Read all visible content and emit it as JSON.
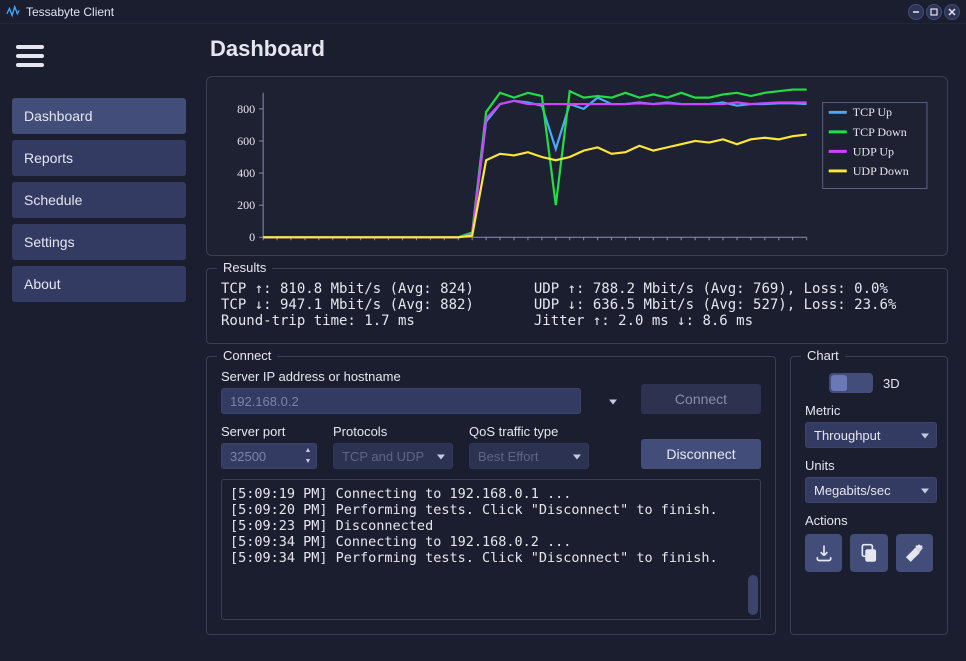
{
  "window": {
    "title": "Tessabyte Client"
  },
  "sidebar": {
    "items": [
      "Dashboard",
      "Reports",
      "Schedule",
      "Settings",
      "About"
    ],
    "active": 0
  },
  "page_title": "Dashboard",
  "results": {
    "legend": "Results",
    "left": "TCP ↑: 810.8 Mbit/s (Avg: 824)\nTCP ↓: 947.1 Mbit/s (Avg: 882)\nRound-trip time: 1.7 ms",
    "right": "UDP ↑: 788.2 Mbit/s (Avg: 769), Loss: 0.0%\nUDP ↓: 636.5 Mbit/s (Avg: 527), Loss: 23.6%\nJitter ↑: 2.0 ms ↓: 8.6 ms"
  },
  "connect": {
    "legend": "Connect",
    "host_label": "Server IP address or hostname",
    "host_value": "192.168.0.2",
    "port_label": "Server port",
    "port_value": "32500",
    "proto_label": "Protocols",
    "proto_value": "TCP and UDP",
    "qos_label": "QoS traffic type",
    "qos_value": "Best Effort",
    "connect_btn": "Connect",
    "disconnect_btn": "Disconnect",
    "log": "[5:09:19 PM] Connecting to 192.168.0.1 ...\n[5:09:20 PM] Performing tests. Click \"Disconnect\" to finish.\n[5:09:23 PM] Disconnected\n[5:09:34 PM] Connecting to 192.168.0.2 ...\n[5:09:34 PM] Performing tests. Click \"Disconnect\" to finish."
  },
  "chart_panel": {
    "legend": "Chart",
    "toggle_3d_label": "3D",
    "metric_label": "Metric",
    "metric_value": "Throughput",
    "units_label": "Units",
    "units_value": "Megabits/sec",
    "actions_label": "Actions"
  },
  "chart_data": {
    "type": "line",
    "ylabel": "",
    "xlabel": "",
    "ylim": [
      0,
      900
    ],
    "yticks": [
      0,
      200,
      400,
      600,
      800
    ],
    "legend_entries": [
      "TCP Up",
      "TCP Down",
      "UDP Up",
      "UDP Down"
    ],
    "colors": {
      "TCP Up": "#4aa8ff",
      "TCP Down": "#22dd44",
      "UDP Up": "#cc44ff",
      "UDP Down": "#ffe838"
    },
    "series": [
      {
        "name": "TCP Up",
        "values": [
          0,
          0,
          0,
          0,
          0,
          0,
          0,
          0,
          0,
          0,
          0,
          0,
          0,
          0,
          0,
          20,
          720,
          830,
          850,
          840,
          820,
          550,
          830,
          800,
          870,
          830,
          830,
          840,
          830,
          840,
          830,
          830,
          830,
          840,
          820,
          830,
          830,
          835,
          835,
          830
        ]
      },
      {
        "name": "TCP Down",
        "values": [
          0,
          0,
          0,
          0,
          0,
          0,
          0,
          0,
          0,
          0,
          0,
          0,
          0,
          0,
          0,
          30,
          780,
          900,
          870,
          900,
          880,
          200,
          910,
          870,
          880,
          870,
          900,
          870,
          890,
          870,
          900,
          870,
          870,
          890,
          900,
          880,
          900,
          910,
          920,
          920
        ]
      },
      {
        "name": "UDP Up",
        "values": [
          0,
          0,
          0,
          0,
          0,
          0,
          0,
          0,
          0,
          0,
          0,
          0,
          0,
          0,
          0,
          15,
          740,
          830,
          850,
          830,
          830,
          830,
          830,
          830,
          830,
          830,
          830,
          835,
          830,
          835,
          830,
          830,
          830,
          830,
          840,
          830,
          835,
          840,
          840,
          840
        ]
      },
      {
        "name": "UDP Down",
        "values": [
          0,
          0,
          0,
          0,
          0,
          0,
          0,
          0,
          0,
          0,
          0,
          0,
          0,
          0,
          0,
          10,
          480,
          520,
          510,
          530,
          500,
          480,
          500,
          540,
          560,
          520,
          530,
          570,
          540,
          560,
          580,
          600,
          590,
          610,
          580,
          610,
          620,
          610,
          630,
          640
        ]
      }
    ]
  }
}
